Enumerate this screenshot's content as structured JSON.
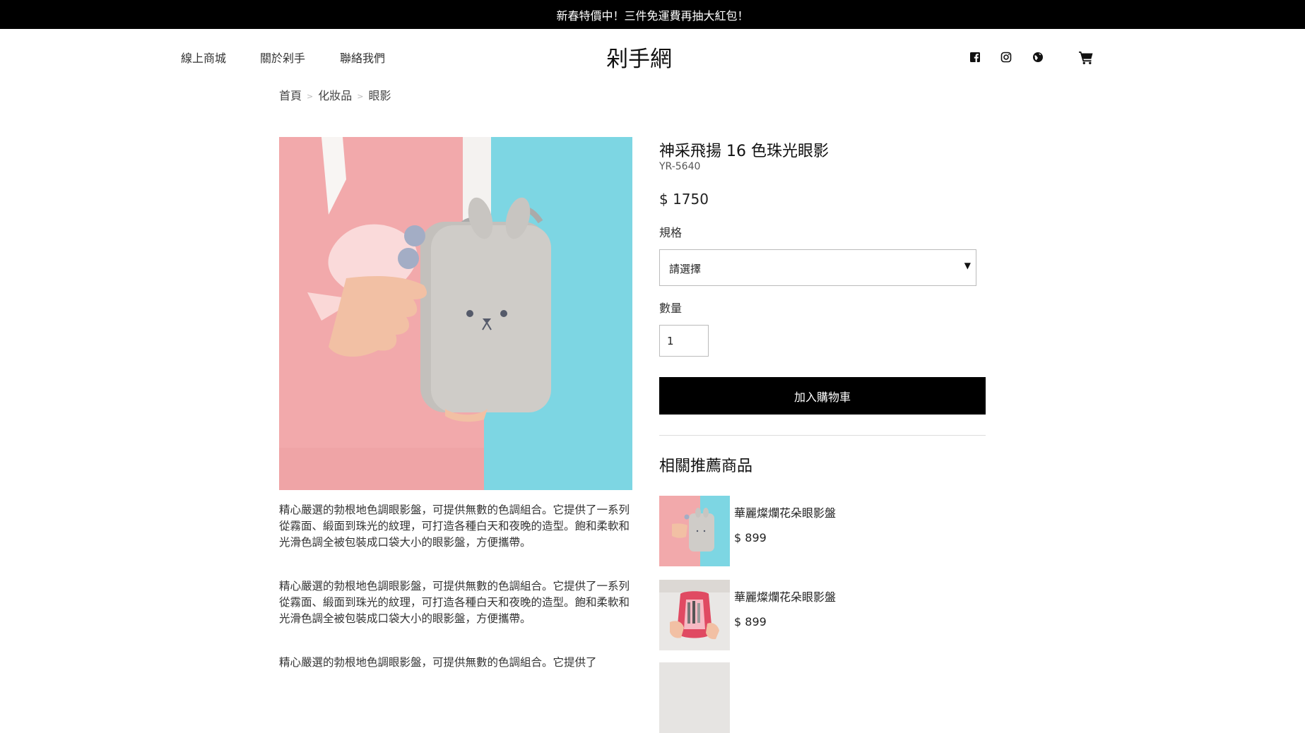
{
  "promo": {
    "text": "新春特價中！三件免運費再抽大紅包！"
  },
  "nav": {
    "links": [
      {
        "label": "線上商城"
      },
      {
        "label": "關於剁手"
      },
      {
        "label": "聯絡我們"
      }
    ],
    "logo": "剁手網",
    "icons": [
      "facebook-icon",
      "instagram-icon",
      "globe-icon",
      "cart-icon"
    ]
  },
  "breadcrumb": [
    "首頁",
    "化妝品",
    "眼影"
  ],
  "product": {
    "title": "神采飛揚 16 色珠光眼影",
    "sku": "YR-5640",
    "price": "$ 1750",
    "variant_label": "規格",
    "variant_value": "請選擇",
    "qty_label": "數量",
    "qty_value": "1",
    "add_to_cart": "加入購物車",
    "description": [
      "精心嚴選的勃根地色調眼影盤，可提供無數的色調組合。它提供了一系列從霧面、緞面到珠光的紋理，可打造各種白天和夜晚的造型。飽和柔軟和光滑色調全被包裝成口袋大小的眼影盤，方便攜帶。",
      "精心嚴選的勃根地色調眼影盤，可提供無數的色調組合。它提供了一系列從霧面、緞面到珠光的紋理，可打造各種白天和夜晚的造型。飽和柔軟和光滑色調全被包裝成口袋大小的眼影盤，方便攜帶。",
      "精心嚴選的勃根地色調眼影盤，可提供無數的色調組合。它提供了"
    ]
  },
  "related": {
    "heading": "相關推薦商品",
    "items": [
      {
        "name": "華麗燦爛花朵眼影盤",
        "price": "$ 899"
      },
      {
        "name": "華麗燦爛花朵眼影盤",
        "price": "$ 899"
      }
    ]
  },
  "colors": {
    "promo_bg": "#000000",
    "button_bg": "#000000",
    "image_bg_left": "#f2a9ab",
    "image_bg_right": "#7dd6e3"
  }
}
